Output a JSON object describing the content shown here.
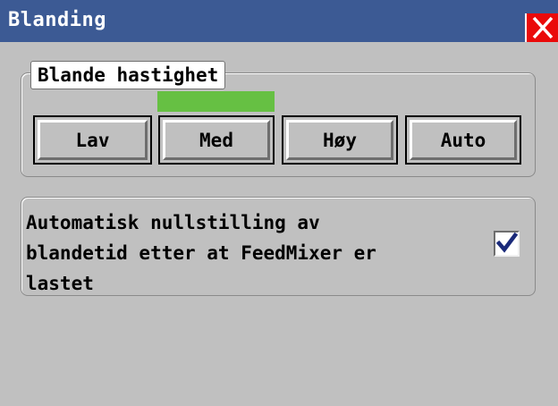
{
  "window": {
    "title": "Blanding",
    "titlebar_color": "#3c5a94",
    "close_color": "#ea0a0a"
  },
  "speed_group": {
    "legend": "Blande hastighet",
    "selected": "Med",
    "indicator_color": "#66c043",
    "buttons": [
      {
        "label": "Lav"
      },
      {
        "label": "Med"
      },
      {
        "label": "Høy"
      },
      {
        "label": "Auto"
      }
    ]
  },
  "auto_reset": {
    "label": "Automatisk nullstilling av\nblandetid etter at FeedMixer er\nlastet",
    "checked": true
  }
}
